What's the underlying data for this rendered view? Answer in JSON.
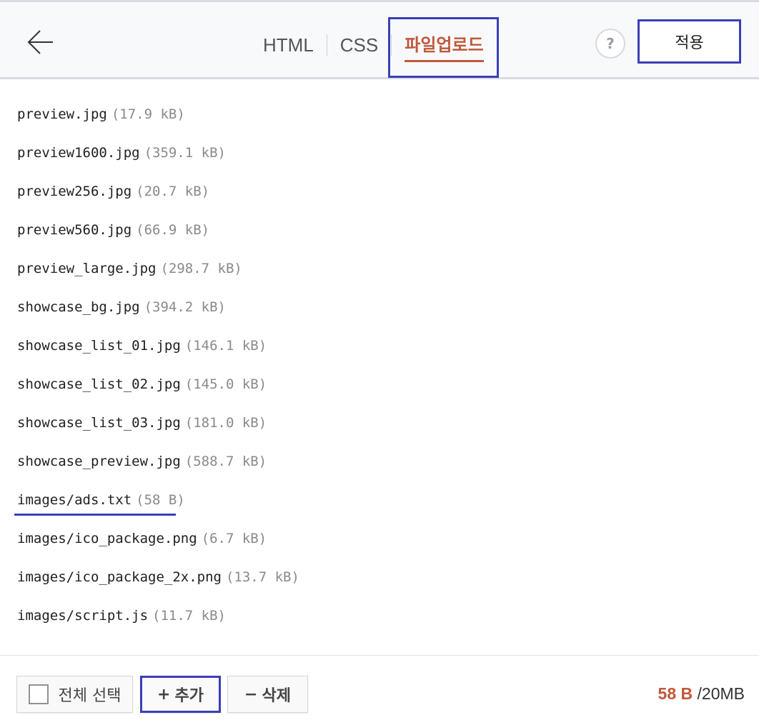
{
  "header": {
    "tabs": [
      {
        "label": "HTML"
      },
      {
        "label": "CSS"
      },
      {
        "label": "파일업로드"
      }
    ],
    "help_label": "?",
    "apply_label": "적용"
  },
  "files": [
    {
      "name": "preview.jpg",
      "size": "(17.9 kB)"
    },
    {
      "name": "preview1600.jpg",
      "size": "(359.1 kB)"
    },
    {
      "name": "preview256.jpg",
      "size": "(20.7 kB)"
    },
    {
      "name": "preview560.jpg",
      "size": "(66.9 kB)"
    },
    {
      "name": "preview_large.jpg",
      "size": "(298.7 kB)"
    },
    {
      "name": "showcase_bg.jpg",
      "size": "(394.2 kB)"
    },
    {
      "name": "showcase_list_01.jpg",
      "size": "(146.1 kB)"
    },
    {
      "name": "showcase_list_02.jpg",
      "size": "(145.0 kB)"
    },
    {
      "name": "showcase_list_03.jpg",
      "size": "(181.0 kB)"
    },
    {
      "name": "showcase_preview.jpg",
      "size": "(588.7 kB)"
    },
    {
      "name": "images/ads.txt",
      "size": "(58 B)"
    },
    {
      "name": "images/ico_package.png",
      "size": "(6.7 kB)"
    },
    {
      "name": "images/ico_package_2x.png",
      "size": "(13.7 kB)"
    },
    {
      "name": "images/script.js",
      "size": "(11.7 kB)"
    }
  ],
  "footer": {
    "select_all_label": "전체 선택",
    "add_glyph": "+",
    "add_label": "추가",
    "delete_glyph": "−",
    "delete_label": "삭제",
    "usage_used": "58 B",
    "usage_separator": "/",
    "usage_total": "20MB"
  },
  "colors": {
    "accent": "#c0583a",
    "highlight": "#3a3fb8"
  }
}
